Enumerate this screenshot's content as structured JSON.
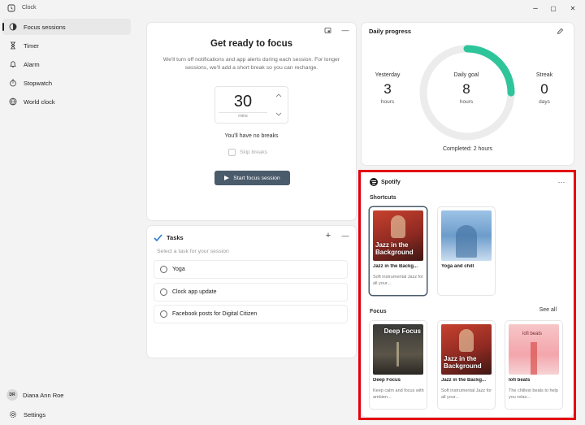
{
  "titlebar": {
    "app_name": "Clock",
    "minimize": "–",
    "maximize": "▢",
    "close": "✕"
  },
  "sidebar": {
    "items": [
      {
        "label": "Focus sessions",
        "icon": "focus-icon",
        "active": true
      },
      {
        "label": "Timer",
        "icon": "hourglass-icon"
      },
      {
        "label": "Alarm",
        "icon": "bell-icon"
      },
      {
        "label": "Stopwatch",
        "icon": "stopwatch-icon"
      },
      {
        "label": "World clock",
        "icon": "globe-icon"
      }
    ],
    "user": {
      "initials": "DR",
      "name": "Diana Ann Roe"
    },
    "settings_label": "Settings"
  },
  "focus": {
    "title": "Get ready to focus",
    "description": "We'll turn off notifications and app alerts during each session. For longer sessions, we'll add a short break so you can recharge.",
    "minutes": "30",
    "unit": "mins",
    "breaks_text": "You'll have no breaks",
    "skip_breaks_label": "Skip breaks",
    "start_label": "Start focus session"
  },
  "tasks": {
    "title": "Tasks",
    "subtitle": "Select a task for your session",
    "items": [
      "Yoga",
      "Clock app update",
      "Facebook posts for Digital Citizen"
    ]
  },
  "progress": {
    "title": "Daily progress",
    "yesterday": {
      "label": "Yesterday",
      "value": "3",
      "unit": "hours"
    },
    "goal": {
      "label": "Daily goal",
      "value": "8",
      "unit": "hours"
    },
    "streak": {
      "label": "Streak",
      "value": "0",
      "unit": "days"
    },
    "completed_text": "Completed: 2 hours",
    "completed_fraction": 0.25,
    "accent": "#2fc59b"
  },
  "spotify": {
    "title": "Spotify",
    "shortcuts_label": "Shortcuts",
    "focus_label": "Focus",
    "see_all": "See all",
    "shortcuts": [
      {
        "name": "Jazz in the Backg...",
        "desc": "Soft instrumental Jazz for all your...",
        "art_text": "Jazz in the Background"
      },
      {
        "name": "Yoga and chill",
        "desc": ""
      }
    ],
    "focus_items": [
      {
        "name": "Deep Focus",
        "desc": "Keep calm and focus with ambien...",
        "art_text": "Deep Focus"
      },
      {
        "name": "Jazz in the Backg...",
        "desc": "Soft instrumental Jazz for all your...",
        "art_text": "Jazz in the Background"
      },
      {
        "name": "lofi beats",
        "desc": "The chillest beats to help you relax...",
        "art_text": "lofi beats"
      }
    ]
  },
  "highlight_color": "#e3000f"
}
